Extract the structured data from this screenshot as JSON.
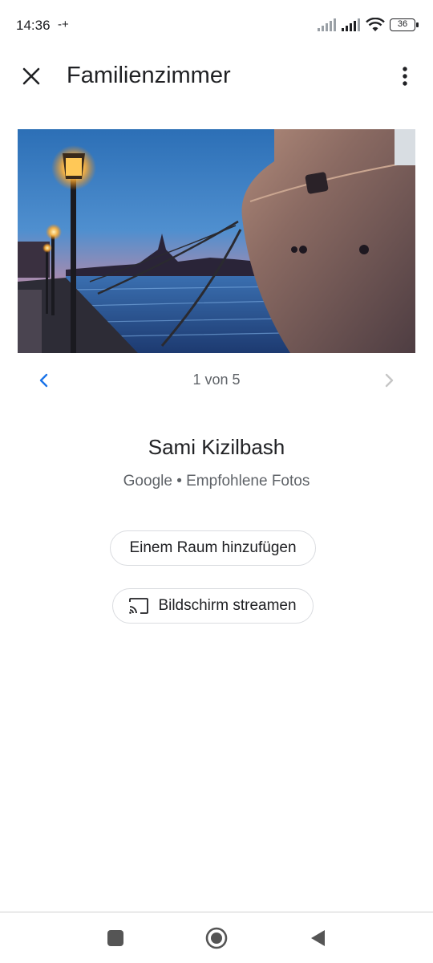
{
  "status_bar": {
    "time": "14:36",
    "extra_indicator": "-+",
    "battery_level": "36",
    "icons": [
      "signal-icon",
      "signal-icon",
      "wifi-icon",
      "battery-icon"
    ]
  },
  "app_bar": {
    "title": "Familienzimmer",
    "close_icon": "close-icon",
    "more_icon": "more-vert-icon"
  },
  "photo": {
    "subject_icon": "harbor-photo"
  },
  "pager": {
    "text": "1 von 5",
    "prev_icon": "chevron-left-icon",
    "next_icon": "chevron-right-icon",
    "accent_color": "#1a73e8",
    "disabled_color": "#c6c6c6"
  },
  "credits": {
    "photographer": "Sami Kizilbash",
    "source": "Google • Empfohlene Fotos"
  },
  "actions": {
    "add_room_label": "Einem Raum hinzufügen",
    "cast_label": "Bildschirm streamen",
    "cast_icon": "cast-icon"
  },
  "nav_bar": {
    "recent_icon": "recent-apps-icon",
    "home_icon": "home-icon",
    "back_icon": "back-icon"
  }
}
